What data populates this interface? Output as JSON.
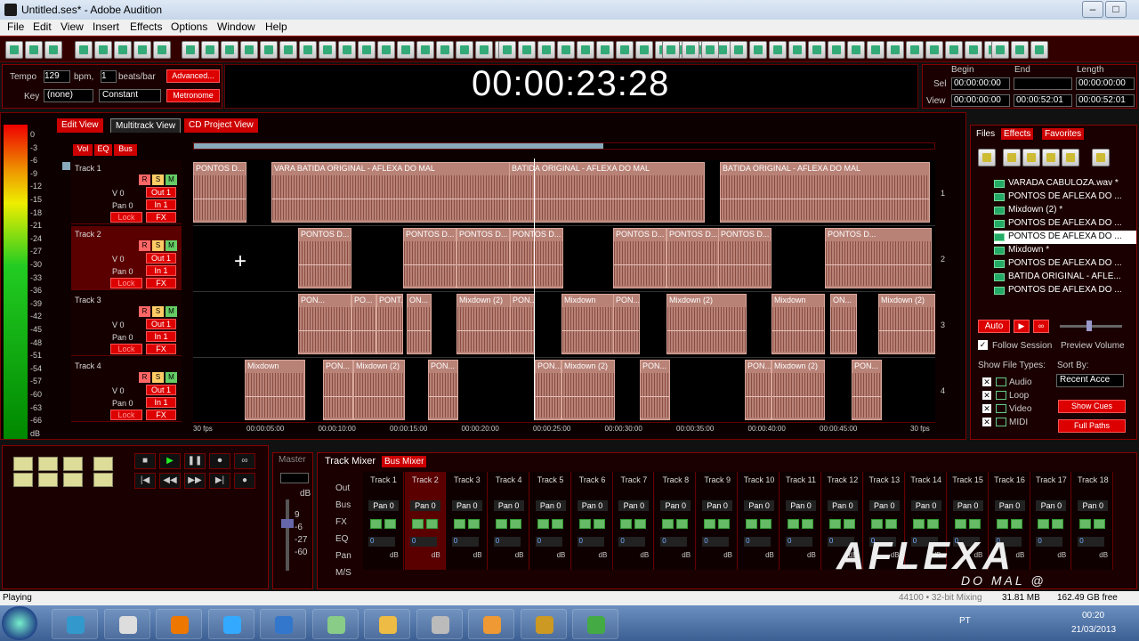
{
  "window": {
    "title": "Untitled.ses* - Adobe Audition",
    "min": "–",
    "max": "□",
    "close": "✕"
  },
  "menu": [
    "File",
    "Edit",
    "View",
    "Insert",
    "Effects",
    "Options",
    "Window",
    "Help"
  ],
  "tempo": {
    "label": "Tempo",
    "value": "129",
    "unit": "bpm,",
    "beats": "1",
    "beats_label": "beats/bar",
    "advanced": "Advanced...",
    "key_label": "Key",
    "key_value": "(none)",
    "mode": "Constant",
    "metronome": "Metronome"
  },
  "time_display": "00:00:23:28",
  "selview": {
    "begin": "Begin",
    "end": "End",
    "length": "Length",
    "sel_label": "Sel",
    "view_label": "View",
    "sel_begin": "00:00:00:00",
    "sel_end": "",
    "sel_length": "00:00:00:00",
    "view_begin": "00:00:00:00",
    "view_end": "00:00:52:01",
    "view_length": "00:00:52:01"
  },
  "view_tabs": [
    "Edit View",
    "Multitrack View",
    "CD Project View"
  ],
  "veb": [
    "Vol",
    "EQ",
    "Bus"
  ],
  "meter_scale": [
    "0",
    "-3",
    "-6",
    "-9",
    "-12",
    "-15",
    "-18",
    "-21",
    "-24",
    "-27",
    "-30",
    "-33",
    "-36",
    "-39",
    "-42",
    "-45",
    "-48",
    "-51",
    "-54",
    "-57",
    "-60",
    "-63",
    "-66",
    "dB"
  ],
  "tracks": [
    {
      "name": "Track 1",
      "vol": "V 0",
      "pan": "Pan 0",
      "out": "Out 1",
      "in": "In 1",
      "lock": "Lock",
      "fx": "FX",
      "num": "1"
    },
    {
      "name": "Track 2",
      "vol": "V 0",
      "pan": "Pan 0",
      "out": "Out 1",
      "in": "In 1",
      "lock": "Lock",
      "fx": "FX",
      "num": "2"
    },
    {
      "name": "Track 3",
      "vol": "V 0",
      "pan": "Pan 0",
      "out": "Out 1",
      "in": "In 1",
      "lock": "Lock",
      "fx": "FX",
      "num": "3"
    },
    {
      "name": "Track 4",
      "vol": "V 0",
      "pan": "Pan 0",
      "out": "Out 1",
      "in": "In 1",
      "lock": "Lock",
      "fx": "FX",
      "num": "4"
    }
  ],
  "rsm": [
    "R",
    "S",
    "M"
  ],
  "clips": {
    "t1": [
      "PONTOS D...",
      "VARA BATIDA ORIGINAL - AFLEXA DO MAL",
      "BATIDA ORIGINAL - AFLEXA DO MAL",
      "BATIDA ORIGINAL - AFLEXA DO MAL"
    ],
    "t2": [
      "PONTOS D...",
      "PONTOS D...",
      "PONTOS D...",
      "PONTOS D...",
      "PONTOS D...",
      "PONTOS D...",
      "PONTOS D...",
      "PONTOS D..."
    ],
    "t3": [
      "PON...",
      "PO...",
      "PONT...",
      "ON...",
      "Mixdown (2)",
      "PON...",
      "Mixdown",
      "PON...",
      "Mixdown (2)",
      "Mixdown",
      "ON...",
      "Mixdown (2)"
    ],
    "t4": [
      "Mixdown",
      "PON...",
      "Mixdown (2)",
      "PON...",
      "PON...",
      "Mixdown (2)",
      "PON...",
      "PON...",
      "Mixdown (2)",
      "PON..."
    ]
  },
  "ruler": [
    "30 fps",
    "00:00:05:00",
    "00:00:10:00",
    "00:00:15:00",
    "00:00:20:00",
    "00:00:25:00",
    "00:00:30:00",
    "00:00:35:00",
    "00:00:40:00",
    "00:00:45:00",
    "30 fps"
  ],
  "files_tabs": [
    "Files",
    "Effects",
    "Favorites"
  ],
  "files": [
    "VARADA CABULOZA.wav *",
    "PONTOS DE AFLEXA DO ...",
    "Mixdown (2) *",
    "PONTOS DE AFLEXA DO ...",
    "PONTOS DE AFLEXA DO ...",
    "Mixdown *",
    "PONTOS DE AFLEXA DO ...",
    "BATIDA ORIGINAL - AFLE...",
    "PONTOS DE AFLEXA DO ..."
  ],
  "files_controls": {
    "auto": "Auto",
    "follow": "Follow Session",
    "preview": "Preview Volume",
    "show_types": "Show File Types:",
    "sort_by": "Sort By:",
    "sort_value": "Recent Acce",
    "types": [
      "Audio",
      "Loop",
      "Video",
      "MIDI"
    ],
    "show_cues": "Show Cues",
    "full_paths": "Full Paths"
  },
  "mixer": {
    "master": "Master",
    "master_db": "dB",
    "master_scale": [
      "9",
      "-6",
      "-27",
      "-60"
    ],
    "tabs": [
      "Track Mixer",
      "Bus Mixer"
    ],
    "rows": [
      "Out",
      "Bus",
      "FX",
      "EQ",
      "Pan",
      "M/S"
    ],
    "tracks": [
      "Track 1",
      "Track 2",
      "Track 3",
      "Track 4",
      "Track 5",
      "Track 6",
      "Track 7",
      "Track 8",
      "Track 9",
      "Track 10",
      "Track 11",
      "Track 12",
      "Track 13",
      "Track 14",
      "Track 15",
      "Track 16",
      "Track 17",
      "Track 18"
    ],
    "pan": "Pan 0",
    "vol": "0",
    "db": "dB"
  },
  "status": {
    "left": "Playing",
    "fmt": "44100 • 32-bit Mixing",
    "mem": "31.81 MB",
    "free": "162.49 GB free"
  },
  "watermark": {
    "big": "AFLEXA",
    "small": "DO MAL @"
  },
  "tray": {
    "lang": "PT",
    "time": "00:20",
    "date": "21/03/2013"
  },
  "accent": "#cc0000"
}
